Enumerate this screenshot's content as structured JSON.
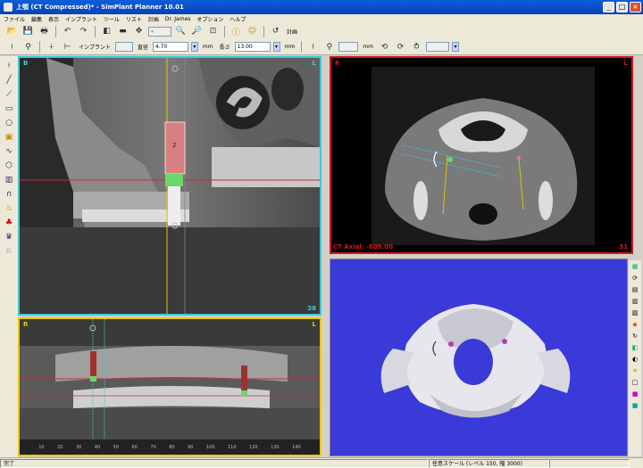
{
  "window": {
    "title": "上顎 (CT Compressed)* - SimPlant Planner  10.01",
    "min": "_",
    "max": "□",
    "close": "×"
  },
  "menu": [
    "ファイル",
    "編集",
    "表示",
    "インプラント",
    "ツール",
    "リスト",
    "計画",
    "Dr. James",
    "オプション",
    "ヘルプ"
  ],
  "toolbar2": {
    "implant_label": "インプラント",
    "implant_value": "",
    "diameter_label": "直径",
    "diameter_value": "4.70",
    "diameter_unit": "mm",
    "length_label": "長さ",
    "length_value": "13.00",
    "length_unit": "mm",
    "plan_label": "計画",
    "field_unit": "mm"
  },
  "views": {
    "cross": {
      "left": "B",
      "right": "L",
      "number": "38"
    },
    "axial": {
      "left": "R",
      "right": "L",
      "label": "CT Axial: -609.00",
      "number": "31"
    },
    "pano": {
      "left": "R",
      "right": "L",
      "ticks": [
        "10",
        "20",
        "30",
        "40",
        "50",
        "60",
        "70",
        "80",
        "90",
        "100",
        "110",
        "120",
        "130",
        "140"
      ]
    }
  },
  "status": {
    "left": "完了",
    "scale": "任意スケール (レベル 150, 幅 3000)"
  },
  "colors": {
    "cross_border": "#3cc8d8",
    "axial_border": "#d01818",
    "pano_border": "#e8c800",
    "render_bg": "#3a3ad8",
    "implant": "#d88080"
  }
}
